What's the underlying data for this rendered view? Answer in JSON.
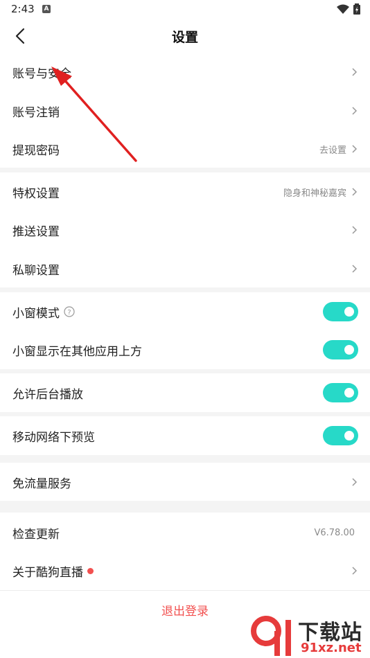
{
  "status_bar": {
    "time": "2:43",
    "badge": "A"
  },
  "nav": {
    "title": "设置"
  },
  "rows": {
    "account_security": {
      "label": "账号与安全"
    },
    "account_cancel": {
      "label": "账号注销"
    },
    "withdraw_password": {
      "label": "提现密码",
      "value": "去设置"
    },
    "privilege": {
      "label": "特权设置",
      "value": "隐身和神秘嘉宾"
    },
    "push": {
      "label": "推送设置"
    },
    "private_chat": {
      "label": "私聊设置"
    },
    "mini_window": {
      "label": "小窗模式",
      "toggle_on": true
    },
    "mini_window_overlay": {
      "label": "小窗显示在其他应用上方",
      "toggle_on": true
    },
    "background_play": {
      "label": "允许后台播放",
      "toggle_on": true
    },
    "mobile_preview": {
      "label": "移动网络下预览",
      "toggle_on": true
    },
    "free_data": {
      "label": "免流量服务"
    },
    "check_update": {
      "label": "检查更新",
      "value": "V6.78.00"
    },
    "about": {
      "label": "关于酷狗直播"
    }
  },
  "logout": {
    "label": "退出登录"
  },
  "watermark": {
    "top": "下载站",
    "bottom": "91xz.net"
  },
  "colors": {
    "accent": "#27d9c8",
    "danger": "#f2504f",
    "section_gap": "#f4f4f4",
    "annotation": "#e02020"
  }
}
